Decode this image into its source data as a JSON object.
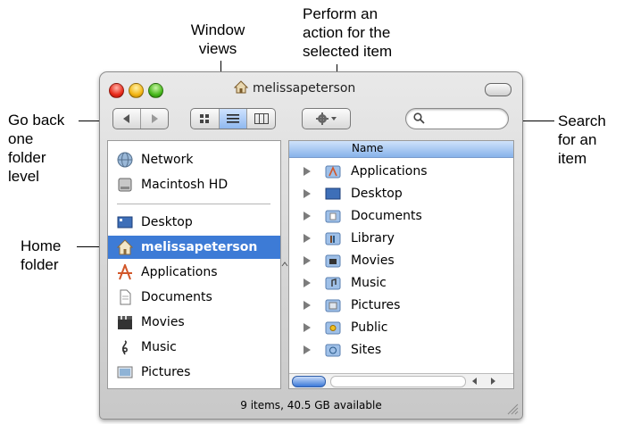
{
  "callouts": {
    "window_views": [
      "Window",
      "views"
    ],
    "perform_action": [
      "Perform an",
      "action for the",
      "selected item"
    ],
    "go_back": [
      "Go back",
      "one",
      "folder",
      "level"
    ],
    "search": [
      "Search",
      "for an",
      "item"
    ],
    "home_folder": [
      "Home",
      "folder"
    ]
  },
  "window": {
    "title": "melissapeterson",
    "status": "9 items, 40.5 GB available"
  },
  "toolbar": {
    "back_icon": "back-arrow-icon",
    "forward_icon": "forward-arrow-icon",
    "view_modes": [
      "icon-view-icon",
      "list-view-icon",
      "column-view-icon"
    ],
    "active_view": "list-view-icon",
    "action_icon": "gear-icon",
    "search_icon": "search-icon"
  },
  "sidebar": {
    "devices": [
      "Network",
      "Macintosh HD"
    ],
    "places": [
      "Desktop",
      "melissapeterson",
      "Applications",
      "Documents",
      "Movies",
      "Music",
      "Pictures"
    ],
    "selected": "melissapeterson"
  },
  "content": {
    "column_header": "Name",
    "items": [
      "Applications",
      "Desktop",
      "Documents",
      "Library",
      "Movies",
      "Music",
      "Pictures",
      "Public",
      "Sites"
    ]
  },
  "colors": {
    "selection": "#3d7bd6",
    "header": "#87b2ea"
  }
}
